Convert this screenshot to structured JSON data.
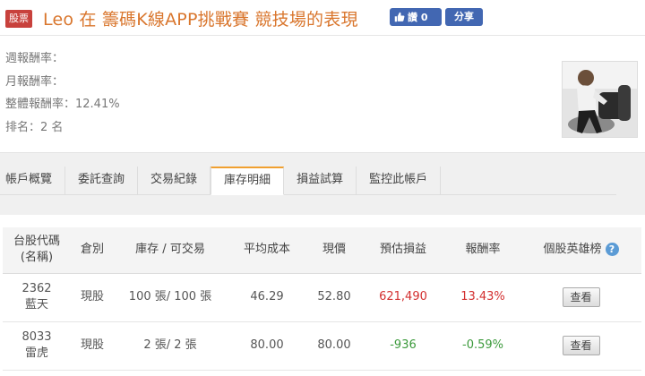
{
  "header": {
    "badge": "股票",
    "title": "Leo 在 籌碼K線APP挑戰賽 競技場的表現",
    "like_label": "讚 0",
    "share_label": "分享"
  },
  "stats": {
    "weekly": "週報酬率：",
    "monthly": "月報酬率：",
    "overall": "整體報酬率：12.41%",
    "rank": "排名：2 名"
  },
  "tabs": [
    {
      "label": "帳戶概覽"
    },
    {
      "label": "委託查詢"
    },
    {
      "label": "交易紀錄"
    },
    {
      "label": "庫存明細",
      "active": true
    },
    {
      "label": "損益試算"
    },
    {
      "label": "監控此帳戶"
    }
  ],
  "table": {
    "headers": {
      "code_line1": "台股代碼",
      "code_line2": "(名稱)",
      "type": "倉別",
      "holdings": "庫存 / 可交易",
      "avg_cost": "平均成本",
      "price": "現價",
      "est_pl": "預估損益",
      "return": "報酬率",
      "heroes": "個股英雄榜",
      "help": "?"
    },
    "rows": [
      {
        "code": "2362",
        "name": "藍天",
        "type": "現股",
        "holdings": "100 張/ 100 張",
        "avg_cost": "46.29",
        "price": "52.80",
        "est_pl": "621,490",
        "return": "13.43%",
        "action": "查看"
      },
      {
        "code": "8033",
        "name": "雷虎",
        "type": "現股",
        "holdings": "2 張/ 2 張",
        "avg_cost": "80.00",
        "price": "80.00",
        "est_pl": "-936",
        "return": "-0.59%",
        "action": "查看"
      }
    ]
  },
  "colors": {
    "title": "#d9762d",
    "badge": "#c8413c",
    "facebook": "#4267b2",
    "positive": "#d32f2f",
    "negative": "#3c9a3c",
    "tab_active_accent": "#f0a030"
  }
}
